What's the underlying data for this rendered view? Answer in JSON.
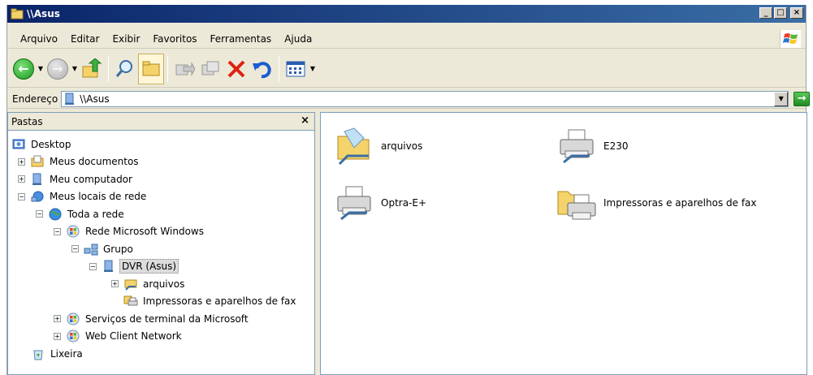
{
  "window": {
    "title": "\\\\Asus",
    "controls": {
      "minimize": "_",
      "maximize": "□",
      "close": "×"
    }
  },
  "menu": [
    "Arquivo",
    "Editar",
    "Exibir",
    "Favoritos",
    "Ferramentas",
    "Ajuda"
  ],
  "toolbar": {
    "icons": [
      "back-icon",
      "forward-icon",
      "up-folder-icon",
      "search-icon",
      "folders-icon",
      "move-to-icon",
      "copy-to-icon",
      "delete-icon",
      "undo-icon",
      "views-icon"
    ]
  },
  "address": {
    "label": "Endereço",
    "value": "\\\\Asus",
    "go_label": "Ir"
  },
  "folders_pane": {
    "title": "Pastas",
    "close": "×",
    "tree": [
      {
        "label": "Desktop",
        "level": 0,
        "toggle": "",
        "icon": "desktop-icon"
      },
      {
        "label": "Meus documentos",
        "level": 1,
        "toggle": "+",
        "icon": "documents-icon"
      },
      {
        "label": "Meu computador",
        "level": 1,
        "toggle": "+",
        "icon": "computer-icon"
      },
      {
        "label": "Meus locais de rede",
        "level": 1,
        "toggle": "−",
        "icon": "network-places-icon"
      },
      {
        "label": "Toda a rede",
        "level": 2,
        "toggle": "−",
        "icon": "globe-icon"
      },
      {
        "label": "Rede Microsoft Windows",
        "level": 3,
        "toggle": "−",
        "icon": "windows-network-icon"
      },
      {
        "label": "Grupo",
        "level": 4,
        "toggle": "−",
        "icon": "workgroup-icon"
      },
      {
        "label": "DVR (Asus)",
        "level": 5,
        "toggle": "−",
        "icon": "computer-icon",
        "selected": true
      },
      {
        "label": "arquivos",
        "level": 6,
        "toggle": "+",
        "icon": "shared-folder-icon"
      },
      {
        "label": "Impressoras e aparelhos de fax",
        "level": 6,
        "toggle": "",
        "icon": "printers-icon"
      },
      {
        "label": "Serviços de terminal da Microsoft",
        "level": 3,
        "toggle": "+",
        "icon": "windows-network-icon"
      },
      {
        "label": "Web Client Network",
        "level": 3,
        "toggle": "+",
        "icon": "windows-network-icon"
      },
      {
        "label": "Lixeira",
        "level": 0,
        "toggle": "",
        "icon": "recycle-bin-icon"
      }
    ]
  },
  "content": {
    "items": [
      {
        "label": "arquivos",
        "icon": "shared-folder-icon"
      },
      {
        "label": "E230",
        "icon": "printer-icon"
      },
      {
        "label": "Optra-E+",
        "icon": "printer-icon"
      },
      {
        "label": "Impressoras e aparelhos de fax",
        "icon": "printers-folder-icon"
      }
    ]
  }
}
